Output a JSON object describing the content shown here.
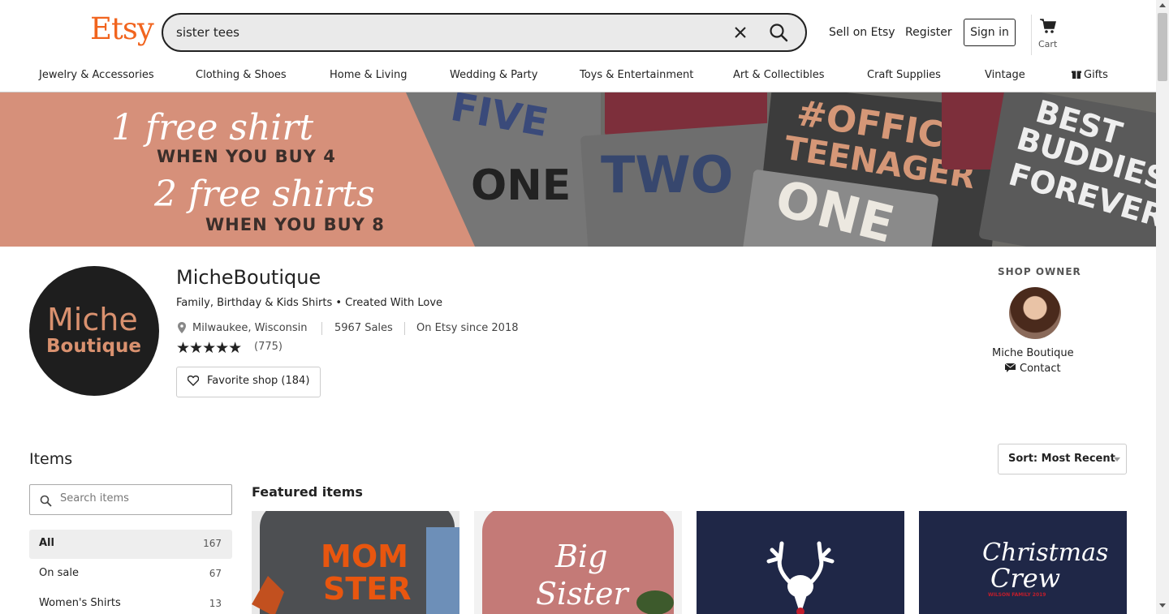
{
  "header": {
    "logo": "Etsy",
    "search_value": "sister tees",
    "sell_label": "Sell on Etsy",
    "register_label": "Register",
    "signin_label": "Sign in",
    "cart_label": "Cart"
  },
  "categories": [
    "Jewelry & Accessories",
    "Clothing & Shoes",
    "Home & Living",
    "Wedding & Party",
    "Toys & Entertainment",
    "Art & Collectibles",
    "Craft Supplies",
    "Vintage",
    "Gifts"
  ],
  "banner": {
    "line1": "1 free shirt",
    "line2": "WHEN YOU BUY 4",
    "line3": "2 free shirts",
    "line4": "WHEN YOU BUY 8",
    "shirts": [
      "FIVE",
      "ONE",
      "TWO",
      "#OFFICIAL",
      "TEENAGER",
      "ONE",
      "BEST",
      "BUDDIES",
      "FOREVER"
    ]
  },
  "shop": {
    "logo_line1": "Miche",
    "logo_line2": "Boutique",
    "name": "MicheBoutique",
    "tagline": "Family, Birthday & Kids Shirts • Created With Love",
    "location": "Milwaukee, Wisconsin",
    "sales": "5967 Sales",
    "since": "On Etsy since 2018",
    "stars": "★★★★★",
    "reviews": "(775)",
    "favorite_label": "Favorite shop (184)"
  },
  "owner": {
    "title": "SHOP OWNER",
    "name": "Miche Boutique",
    "contact_label": "Contact"
  },
  "items": {
    "title": "Items",
    "sort_label": "Sort: Most Recent",
    "search_placeholder": "Search items",
    "sections": [
      {
        "name": "All",
        "count": "167"
      },
      {
        "name": "On sale",
        "count": "67"
      },
      {
        "name": "Women's Shirts",
        "count": "13"
      }
    ],
    "featured_title": "Featured items",
    "featured": [
      {
        "text1": "MOM",
        "text2": "STER"
      },
      {
        "text1": "Big",
        "text2": "Sister"
      },
      {
        "text1": "",
        "text2": ""
      },
      {
        "text1": "Christmas",
        "text2": "Crew",
        "text3": "WILSON FAMILY 2019"
      }
    ]
  },
  "colors": {
    "brand": "#f1641e",
    "banner_left": "#d6907a",
    "shop_logo_bg": "#1e1e1e",
    "shop_logo_text": "#d9916f"
  }
}
